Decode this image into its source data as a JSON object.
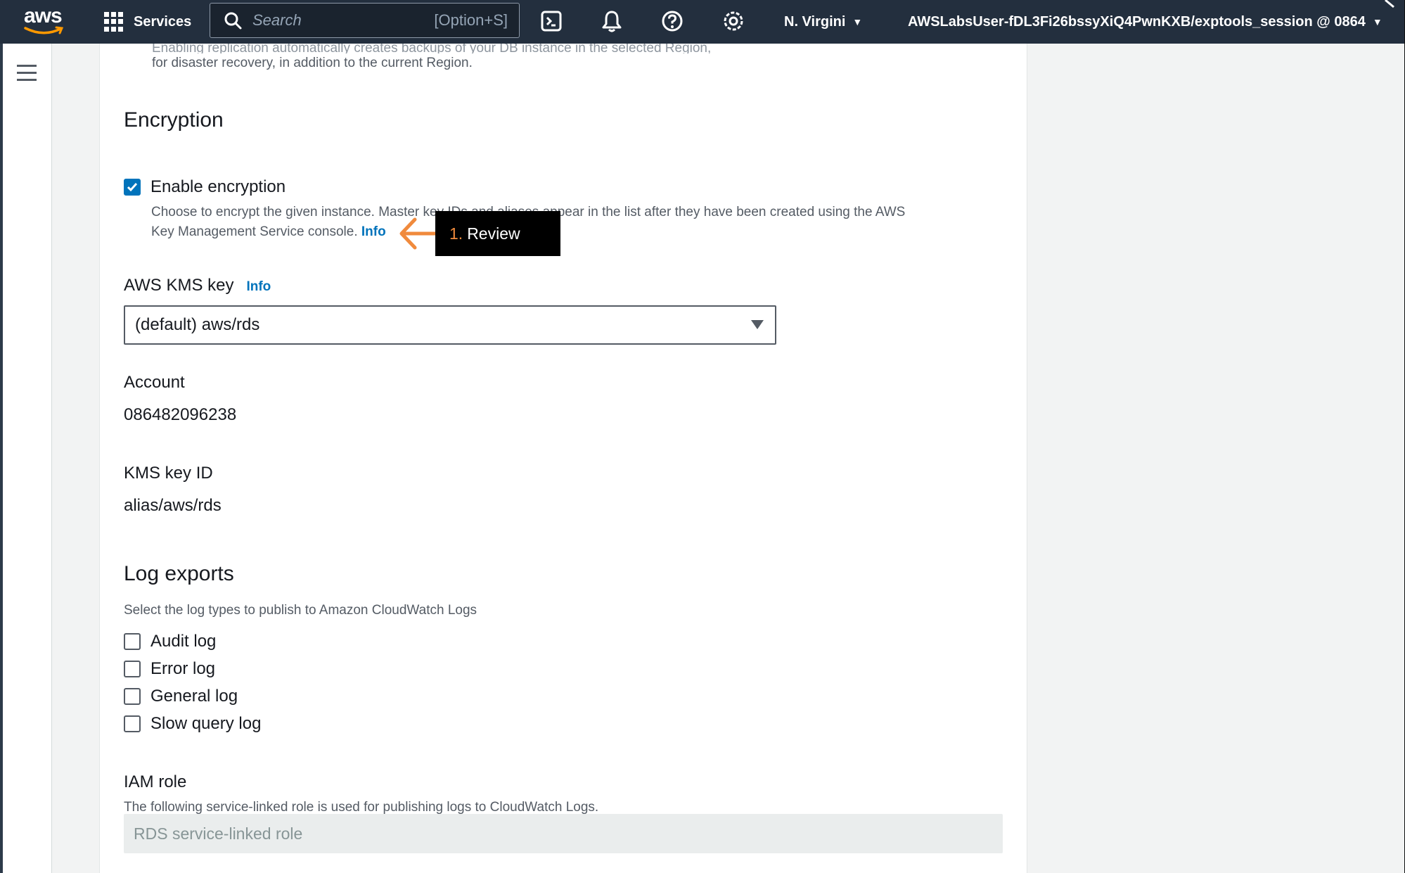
{
  "nav": {
    "logo_text": "aws",
    "services_label": "Services",
    "search_placeholder": "Search",
    "search_shortcut": "[Option+S]",
    "region": "N. Virgini",
    "account": "AWSLabsUser-fDL3Fi26bssyXiQ4PwnKXB/exptools_session @ 0864",
    "icons": [
      "terminal-icon",
      "bell-icon",
      "help-icon",
      "settings-icon"
    ]
  },
  "top_description": {
    "faded_line": "Enabling replication automatically creates backups of your DB instance in the selected Region,",
    "line2": "for disaster recovery, in addition to the current Region."
  },
  "encryption": {
    "heading": "Encryption",
    "enable_label": "Enable encryption",
    "enable_checked": true,
    "description": "Choose to encrypt the given instance. Master key IDs and aliases appear in the list after they have been created using the AWS Key Management Service console.",
    "desc_line1": "Choose to encrypt the given instance. Master key IDs and aliases appear in the list after they have been created using the AWS",
    "desc_line2": "Key Management Service console.",
    "info_label": "Info"
  },
  "tooltip": {
    "number": "1.",
    "text": "Review"
  },
  "kms": {
    "label": "AWS KMS key",
    "info_label": "Info",
    "selected": "(default) aws/rds",
    "account_label": "Account",
    "account_value": "086482096238",
    "key_id_label": "KMS key ID",
    "key_id_value": "alias/aws/rds"
  },
  "log_exports": {
    "heading": "Log exports",
    "description": "Select the log types to publish to Amazon CloudWatch Logs",
    "options": [
      {
        "label": "Audit log",
        "checked": false
      },
      {
        "label": "Error log",
        "checked": false
      },
      {
        "label": "General log",
        "checked": false
      },
      {
        "label": "Slow query log",
        "checked": false
      }
    ]
  },
  "iam": {
    "label": "IAM role",
    "description": "The following service-linked role is used for publishing logs to CloudWatch Logs.",
    "placeholder": "RDS service-linked role"
  },
  "colors": {
    "nav_bg": "#232f3e",
    "link": "#0073bb",
    "annotation_orange": "#f08a3c"
  }
}
